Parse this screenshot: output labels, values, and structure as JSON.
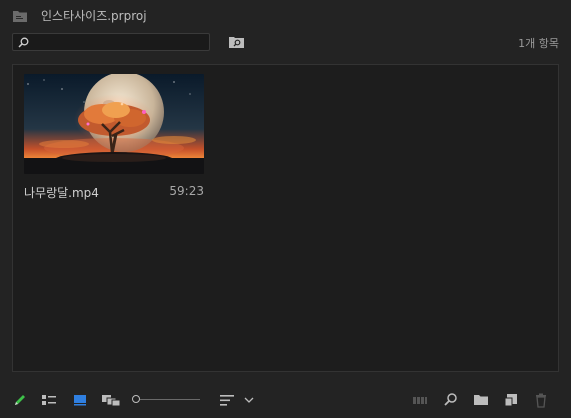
{
  "project": {
    "title": "인스타사이즈.prproj"
  },
  "search": {
    "placeholder": "",
    "value": ""
  },
  "item_count": "1개 항목",
  "clips": [
    {
      "name": "나무랑달.mp4",
      "duration": "59:23"
    }
  ],
  "toolbar": {
    "zoom_level": 0.0,
    "colors": {
      "pencil": "#3ec24a",
      "icon_view_active": "#2f7fe0",
      "icon": "#bdbdbd",
      "disabled": "#555555"
    }
  }
}
